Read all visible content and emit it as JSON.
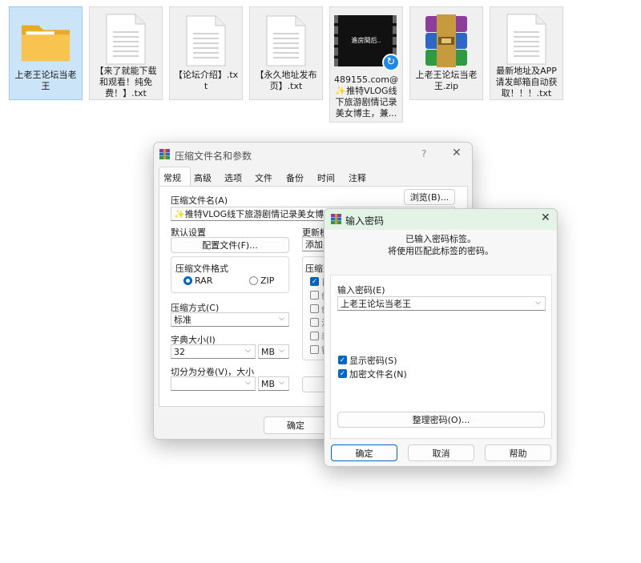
{
  "desktop": {
    "icons": [
      {
        "label": "上老王论坛当老王",
        "type": "folder"
      },
      {
        "label": "【来了就能下载和观看！纯免费！】.txt",
        "type": "txt"
      },
      {
        "label": "【论坛介绍】.txt",
        "type": "txt"
      },
      {
        "label": "【永久地址发布页】.txt",
        "type": "txt"
      },
      {
        "label": "489155.com@ ✨推特VLOG线下旅游剧情记录美女博主，兼...",
        "type": "video",
        "thumb_text": "進房間后.."
      },
      {
        "label": "上老王论坛当老王.zip",
        "type": "zip"
      },
      {
        "label": "最新地址及APP请发邮箱自动获取！！！.txt",
        "type": "txt"
      }
    ]
  },
  "archive_dialog": {
    "title": "压缩文件名和参数",
    "help": "?",
    "close": "✕",
    "tabs": [
      "常规",
      "高级",
      "选项",
      "文件",
      "备份",
      "时间",
      "注释"
    ],
    "archive_name_label": "压缩文件名(A)",
    "browse_button": "浏览(B)...",
    "archive_name_value": "✨推特VLOG线下旅游剧情记录美女博主，兼职",
    "default_settings_label": "默认设置",
    "profile_button": "配置文件(F)...",
    "update_mode_label": "更新模",
    "update_mode_value": "添加并",
    "format_group_label": "压缩文件格式",
    "format_rar": "RAR",
    "format_zip": "ZIP",
    "options_group_label": "压缩选",
    "method_label": "压缩方式(C)",
    "method_value": "标准",
    "dict_label": "字典大小(I)",
    "dict_value": "32",
    "dict_unit": "MB",
    "split_label": "切分为分卷(V)，大小",
    "split_value": "",
    "split_unit": "MB",
    "ok_button": "确定",
    "option_prefixes": [
      "日",
      "创",
      "创",
      "法",
      "表",
      "锁"
    ]
  },
  "password_dialog": {
    "title": "输入密码",
    "close": "✕",
    "info_line1": "已输入密码标签。",
    "info_line2": "将使用匹配此标签的密码。",
    "password_label": "输入密码(E)",
    "password_value": "上老王论坛当老王",
    "show_password": "显示密码(S)",
    "encrypt_names": "加密文件名(N)",
    "organize_button": "整理密码(O)...",
    "ok_button": "确定",
    "cancel_button": "取消",
    "help_button": "帮助"
  },
  "colors": {
    "accent": "#0067c0",
    "folder": "#f8c44f",
    "selected_tile": "#cce4f7"
  }
}
